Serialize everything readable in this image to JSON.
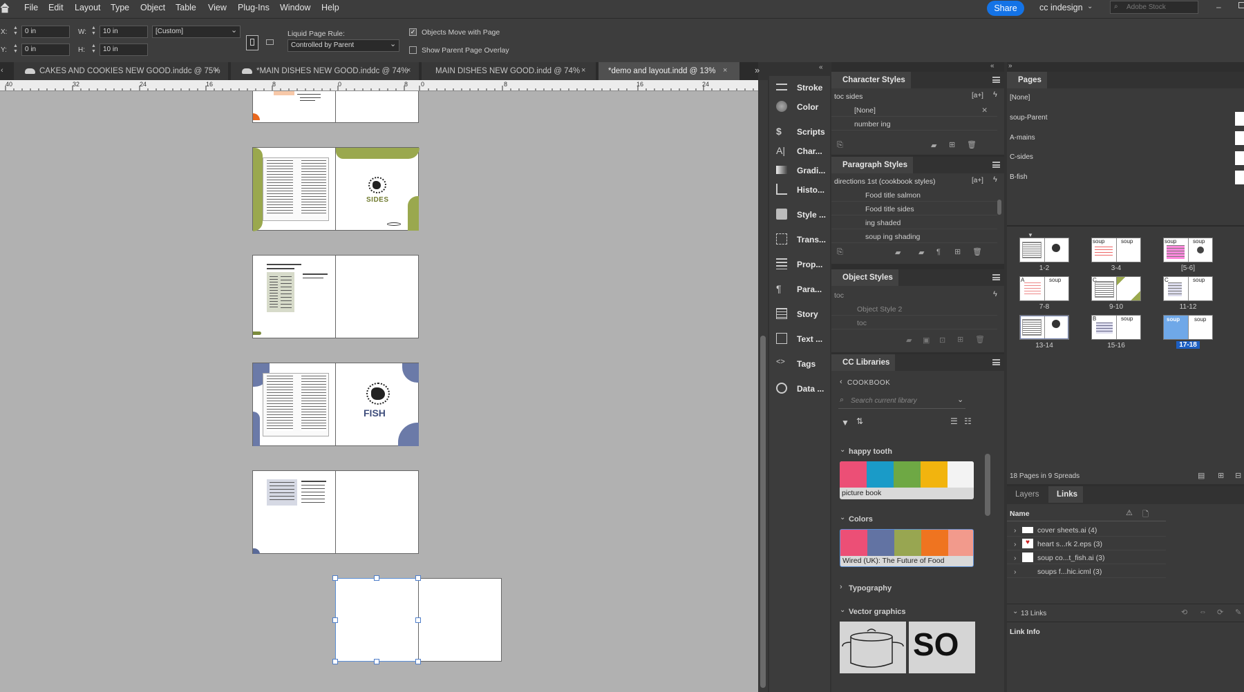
{
  "menubar": {
    "items": [
      "File",
      "Edit",
      "Layout",
      "Type",
      "Object",
      "Table",
      "View",
      "Plug-Ins",
      "Window",
      "Help"
    ],
    "share_label": "Share",
    "workspace": "cc indesign",
    "stock_placeholder": "Adobe Stock"
  },
  "control": {
    "x_label": "X:",
    "x_value": "0 in",
    "y_label": "Y:",
    "y_value": "0 in",
    "w_label": "W:",
    "w_value": "10 in",
    "h_label": "H:",
    "h_value": "10 in",
    "preset": "[Custom]",
    "liquid_label": "Liquid Page Rule:",
    "liquid_value": "Controlled by Parent",
    "objects_move_label": "Objects Move with Page",
    "objects_move_checked": true,
    "show_overlay_label": "Show Parent Page Overlay",
    "show_overlay_checked": false
  },
  "doc_tabs": [
    {
      "label": "CAKES AND COOKIES NEW GOOD.inddc @ 75%",
      "cloud": true,
      "active": false
    },
    {
      "label": "*MAIN DISHES NEW GOOD.inddc @ 74%",
      "cloud": true,
      "active": false
    },
    {
      "label": "MAIN DISHES NEW GOOD.indd @ 74%",
      "cloud": false,
      "active": false
    },
    {
      "label": "*demo and layout.indd @ 13%",
      "cloud": false,
      "active": true
    }
  ],
  "ruler_ticks": [
    "40",
    "32",
    "24",
    "16",
    "8",
    "0",
    "8",
    "0",
    "8",
    "16",
    "24"
  ],
  "canvas": {
    "sides_title": "SIDES",
    "fish_title": "FISH"
  },
  "tools": [
    "Stroke",
    "Color",
    "Scripts",
    "Char...",
    "Gradi...",
    "Histo...",
    "Style ...",
    "Trans...",
    "Prop...",
    "Para...",
    "Story",
    "Text ...",
    "Tags",
    "Data ..."
  ],
  "character_styles": {
    "title": "Character Styles",
    "current": "toc sides",
    "items": [
      "[None]",
      "number ing"
    ]
  },
  "paragraph_styles": {
    "title": "Paragraph Styles",
    "current": "directions 1st (cookbook styles)",
    "items": [
      "Food title salmon",
      "Food title sides",
      "ing shaded",
      "soup ing shading"
    ]
  },
  "object_styles": {
    "title": "Object Styles",
    "current": "toc",
    "items": [
      "Object Style 2",
      "toc"
    ]
  },
  "cc_libraries": {
    "title": "CC Libraries",
    "library": "COOKBOOK",
    "search_placeholder": "Search current library",
    "group1": "happy tooth",
    "theme1_name": "picture book",
    "theme1_colors": [
      "#ec4f76",
      "#1a9bc8",
      "#6ea844",
      "#f2b40e",
      "#f3f3f3"
    ],
    "group2": "Colors",
    "theme2_name": "Wired (UK): The Future of Food",
    "theme2_colors": [
      "#ec4f76",
      "#6273a3",
      "#98a651",
      "#ef7420",
      "#f29a8c"
    ],
    "group3": "Typography",
    "group4": "Vector graphics",
    "vector_text": "SO"
  },
  "pages": {
    "title": "Pages",
    "masters": [
      "[None]",
      "soup-Parent",
      "A-mains",
      "C-sides",
      "B-fish"
    ],
    "spreads": [
      {
        "label": "1-2"
      },
      {
        "label": "3-4"
      },
      {
        "label": "[5-6]"
      },
      {
        "label": "7-8"
      },
      {
        "label": "9-10"
      },
      {
        "label": "11-12"
      },
      {
        "label": "13-14"
      },
      {
        "label": "15-16"
      },
      {
        "label": "17-18"
      }
    ],
    "selected_spread": "17-18",
    "prefix_soup": "soup",
    "prefix_a": "A",
    "prefix_b": "B",
    "prefix_c": "C",
    "summary": "18 Pages in 9 Spreads"
  },
  "links_panel": {
    "tabs": [
      "Layers",
      "Links"
    ],
    "active_tab": "Links",
    "name_header": "Name",
    "items": [
      "cover sheets.ai (4)",
      "heart s...rk 2.eps (3)",
      "soup co...t_fish.ai (3)",
      "soups f...hic.icml (3)"
    ],
    "count": "13 Links",
    "info": "Link Info"
  }
}
